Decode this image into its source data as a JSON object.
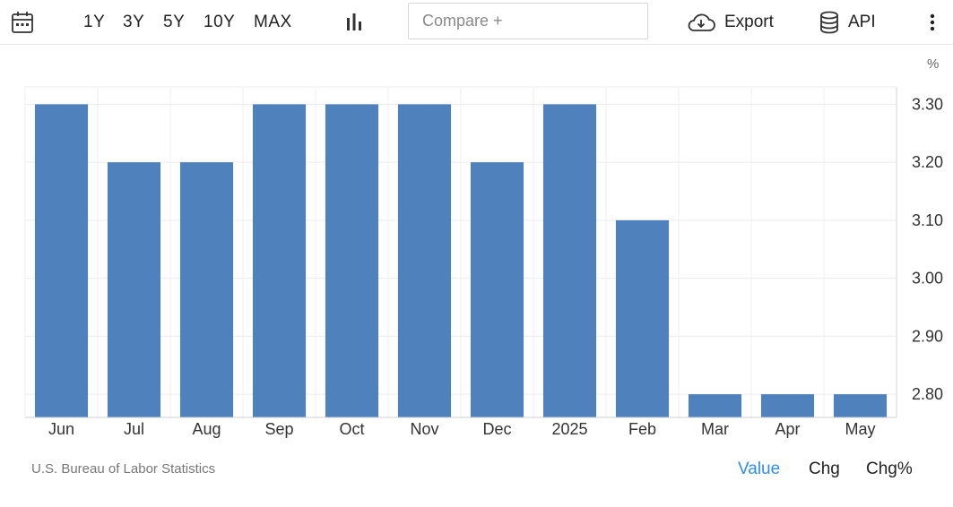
{
  "toolbar": {
    "ranges": [
      "1Y",
      "3Y",
      "5Y",
      "10Y",
      "MAX"
    ],
    "compare_placeholder": "Compare +",
    "export_label": "Export",
    "api_label": "API",
    "icons": [
      "calendar-icon",
      "chart-type-icon",
      "cloud-download-icon",
      "database-icon",
      "more-vertical-icon"
    ]
  },
  "chart_unit": "%",
  "source": "U.S. Bureau of Labor Statistics",
  "view_tabs": {
    "value": "Value",
    "chg": "Chg",
    "chg_pct": "Chg%",
    "active": "Value"
  },
  "colors": {
    "bar": "#4f81bd",
    "active_tab": "#2f8ee6"
  },
  "chart_data": {
    "type": "bar",
    "categories": [
      "Jun",
      "Jul",
      "Aug",
      "Sep",
      "Oct",
      "Nov",
      "Dec",
      "2025",
      "Feb",
      "Mar",
      "Apr",
      "May"
    ],
    "values": [
      3.3,
      3.2,
      3.2,
      3.3,
      3.3,
      3.3,
      3.2,
      3.3,
      3.1,
      2.8,
      2.8,
      2.8
    ],
    "yticks": [
      "3.30",
      "3.20",
      "3.10",
      "3.00",
      "2.90",
      "2.80"
    ],
    "ylim": [
      2.76,
      3.33
    ],
    "y_axis_position": "right",
    "grid": true,
    "title": "",
    "xlabel": "",
    "ylabel": ""
  }
}
